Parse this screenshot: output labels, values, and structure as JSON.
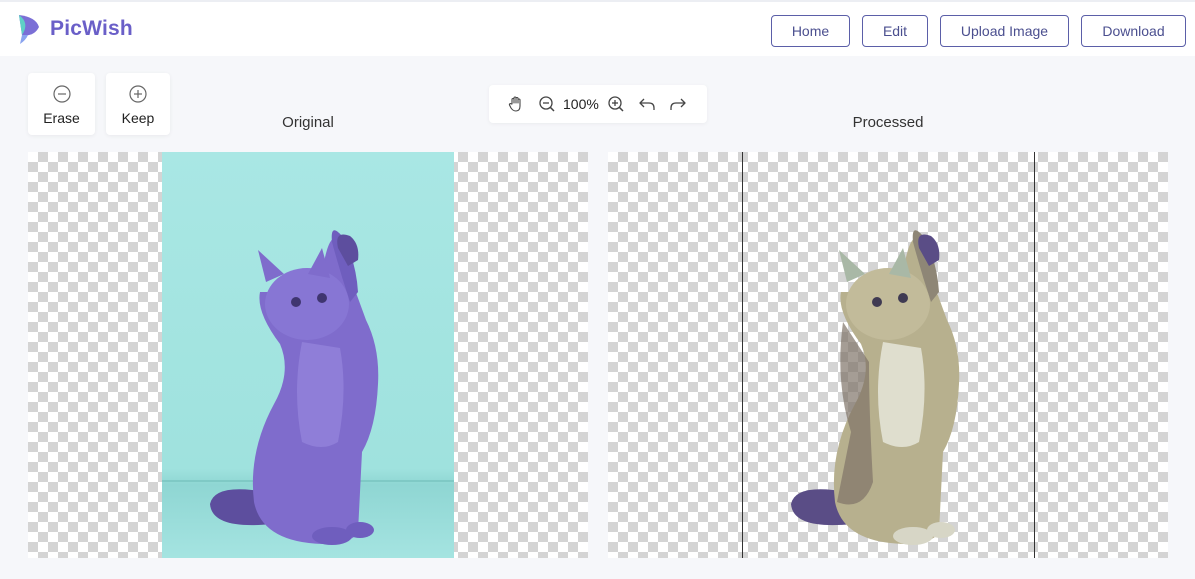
{
  "brand": {
    "name": "PicWish"
  },
  "nav": {
    "home": "Home",
    "edit": "Edit",
    "upload": "Upload Image",
    "download": "Download"
  },
  "tools": {
    "erase": "Erase",
    "keep": "Keep"
  },
  "zoom": {
    "level": "100%"
  },
  "panes": {
    "original_title": "Original",
    "processed_title": "Processed"
  },
  "colors": {
    "brand": "#6a5fc8",
    "button_border": "#5b5fa8",
    "cat_original": "#7f6ccc",
    "cat_processed_fur": "#b7b08e",
    "background_teal": "#a9e7e4"
  },
  "icons": {
    "erase": "circle-minus-icon",
    "keep": "circle-plus-icon",
    "pan": "hand-icon",
    "zoom_out": "zoom-out-icon",
    "zoom_in": "zoom-in-icon",
    "undo": "undo-icon",
    "redo": "redo-icon"
  }
}
